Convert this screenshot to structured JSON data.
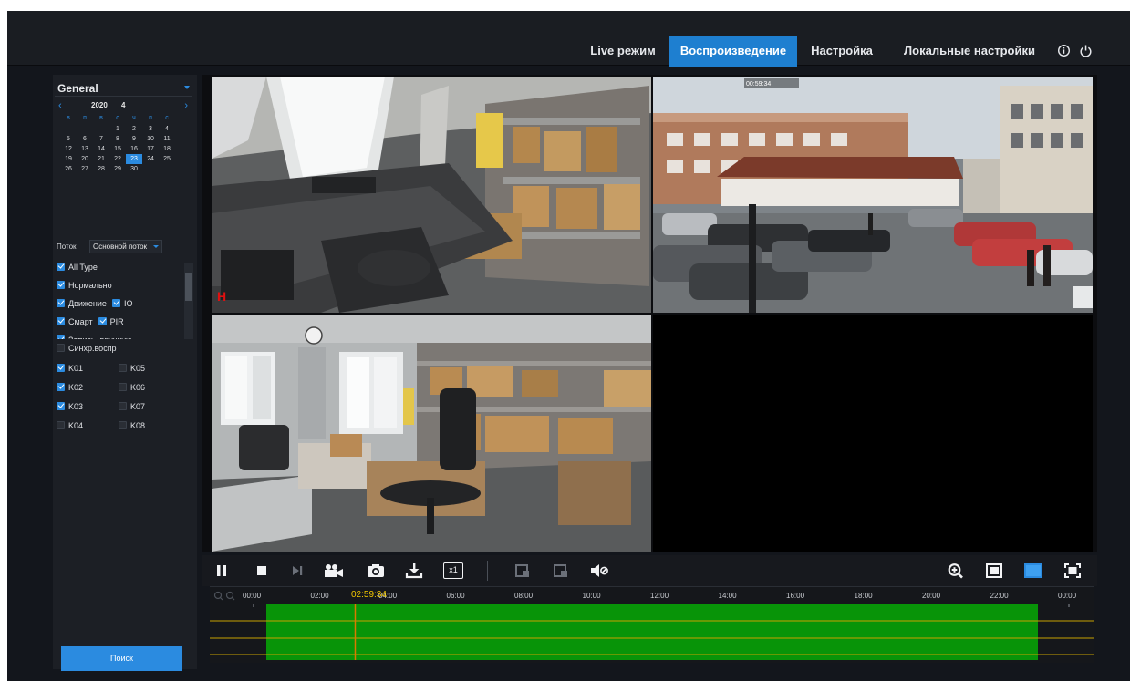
{
  "nav": {
    "items": [
      "Live режим",
      "Воспроизведение",
      "Настройка",
      "Локальные настройки"
    ],
    "active": 1,
    "icons": [
      "info-icon",
      "power-icon"
    ]
  },
  "side": {
    "group": "General",
    "calendar": {
      "year": "2020",
      "month": "4",
      "prev": "‹",
      "next": "›",
      "weekdays": [
        "в",
        "п",
        "в",
        "с",
        "ч",
        "п",
        "с"
      ],
      "lead_blank": 3,
      "days": [
        "1",
        "2",
        "3",
        "4",
        "5",
        "6",
        "7",
        "8",
        "9",
        "10",
        "11",
        "12",
        "13",
        "14",
        "15",
        "16",
        "17",
        "18",
        "19",
        "20",
        "21",
        "22",
        "23",
        "24",
        "25",
        "26",
        "27",
        "28",
        "29",
        "30"
      ],
      "selected_day": "23"
    },
    "stream_label": "Поток",
    "stream_value": "Основной поток",
    "types": [
      {
        "label": "All Type",
        "checked": true
      },
      {
        "label": "Нормально",
        "checked": true
      },
      {
        "label": "Движение",
        "checked": true,
        "label2": "IO",
        "checked2": true
      },
      {
        "label": "Смарт",
        "checked": true,
        "label2": "PIR",
        "checked2": true
      },
      {
        "label": "Запись, вручную",
        "checked": true
      }
    ],
    "sync_label": "Синхр.воспр",
    "channels": [
      {
        "label": "K01",
        "checked": true
      },
      {
        "label": "K05",
        "checked": false
      },
      {
        "label": "K02",
        "checked": true
      },
      {
        "label": "K06",
        "checked": false
      },
      {
        "label": "K03",
        "checked": true
      },
      {
        "label": "K07",
        "checked": false
      },
      {
        "label": "K04",
        "checked": false
      },
      {
        "label": "K08",
        "checked": false
      }
    ],
    "search_label": "Поиск"
  },
  "overlays": {
    "cam1_mark": "H",
    "cam2_osd": "00:59:34"
  },
  "controls": {
    "left_icons": [
      "pause-icon",
      "stop-icon",
      "next-frame-icon",
      "record-clip-icon",
      "snapshot-icon",
      "download-icon",
      "speed-x1-icon"
    ],
    "speed_label": "x1",
    "mid_icons": [
      "clip-start-icon",
      "clip-end-icon",
      "audio-mute-icon"
    ],
    "right_icons": [
      "zoom-in-icon",
      "single-view-icon",
      "quad-view-icon",
      "fullscreen-icon"
    ]
  },
  "timeline": {
    "current_time": "02:59:34",
    "ticks": [
      "00:00",
      "02:00",
      "04:00",
      "06:00",
      "08:00",
      "10:00",
      "12:00",
      "14:00",
      "16:00",
      "18:00",
      "20:00",
      "22:00",
      "00:00"
    ],
    "recording_color": "#089408",
    "cursor_color": "#d97a00",
    "track_line_color": "#c8a000"
  },
  "colors": {
    "accent": "#2b8be0",
    "background": "#13161c"
  }
}
